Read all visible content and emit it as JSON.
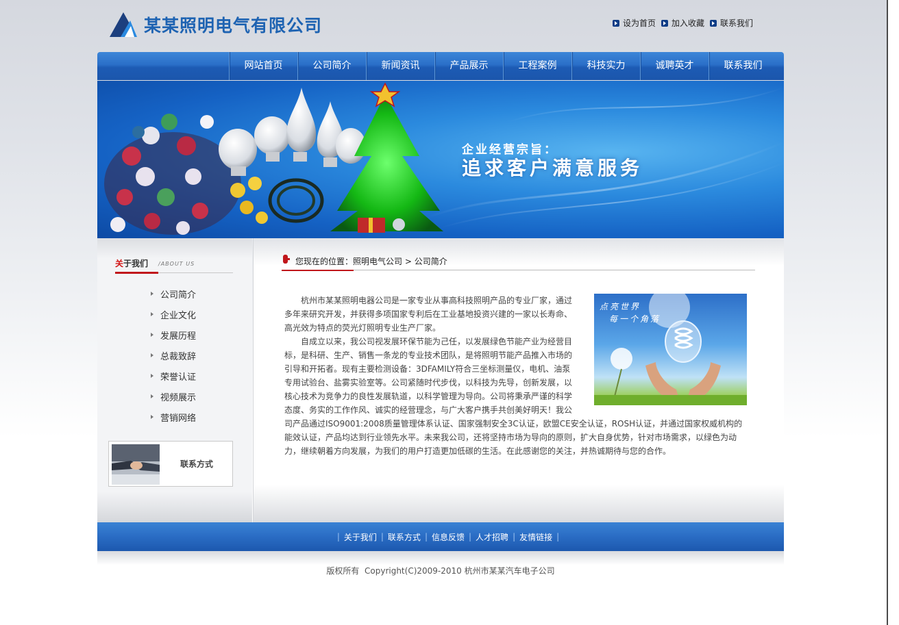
{
  "header": {
    "company_name": "某某照明电气有限公司",
    "top_links": [
      "设为首页",
      "加入收藏",
      "联系我们"
    ]
  },
  "nav": {
    "items": [
      "网站首页",
      "公司简介",
      "新闻资讯",
      "产品展示",
      "工程案例",
      "科技实力",
      "诚聘英才",
      "联系我们"
    ]
  },
  "banner": {
    "line1": "企业经营宗旨：",
    "line2": "追求客户满意服务"
  },
  "sidebar": {
    "title_first_char": "关",
    "title_rest": "于我们",
    "title_en": "/ABOUT US",
    "items": [
      "公司简介",
      "企业文化",
      "发展历程",
      "总裁致辞",
      "荣誉认证",
      "视频展示",
      "营销网络"
    ],
    "contact_label": "联系方式"
  },
  "main": {
    "breadcrumb_prefix": "您现在的位置：",
    "breadcrumb_home": "照明电气公司",
    "breadcrumb_sep": " > ",
    "breadcrumb_current": "公司简介",
    "image_caption_1": "点亮世界",
    "image_caption_2": "每一个角落",
    "paragraphs": [
      "杭州市某某照明电器公司是一家专业从事高科技照明产品的专业厂家，通过多年来研究开发，并获得多项国家专利后在工业基地投资兴建的一家以长寿命、高光效为特点的荧光灯照明专业生产厂家。",
      "自成立以来，我公司视发展环保节能为己任，以发展绿色节能产业为经营目标，是科研、生产、销售一条龙的专业技术团队，是将照明节能产品推入市场的引导和开拓者。现有主要检测设备：3DFAMILY符合三坐标测量仪，电机、油泵专用试验台、盐雾实验室等。公司紧随时代步伐，以科技为先导，创新发展，以核心技术为竞争力的良性发展轨道，以科学管理为导向。公司将秉承严谨的科学态度、务实的工作作风、诚实的经营理念，与广大客户携手共创美好明天！我公司产品通过ISO9001:2008质量管理体系认证、国家强制安全3C认证，欧盟CE安全认证，ROSH认证，并通过国家权威机构的能效认证，产品均达到行业领先水平。未来我公司，还将坚持市场为导向的原则，扩大自身优势，针对市场需求，以绿色为动力，继续朝着方向发展，为我们的用户打造更加低碳的生活。在此感谢您的关注，并热诚期待与您的合作。"
    ]
  },
  "footer": {
    "links": [
      "关于我们",
      "联系方式",
      "信息反馈",
      "人才招聘",
      "友情链接"
    ],
    "separator": "|",
    "copyright": "版权所有  Copyright(C)2009-2010 杭州市某某汽车电子公司"
  },
  "colors": {
    "brand_blue": "#1e63b2",
    "nav_blue": "#2a6fc8",
    "accent_red": "#c0161b"
  },
  "icons": [
    "logo-triangle-icon",
    "arrow-bullet-icon",
    "triangle-bullet-icon",
    "location-pin-icon"
  ]
}
